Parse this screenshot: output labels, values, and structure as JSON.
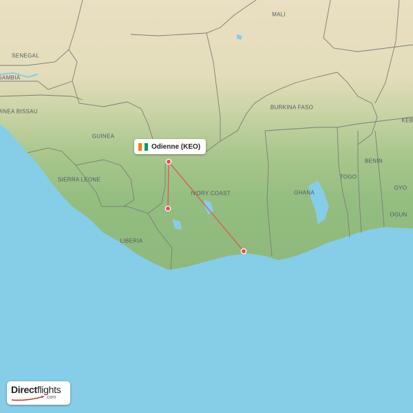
{
  "map": {
    "country_labels": [
      {
        "key": "mali",
        "text": "MALI"
      },
      {
        "key": "senegal",
        "text": "SENEGAL"
      },
      {
        "key": "gambia",
        "text": "GAMBIA"
      },
      {
        "key": "guinea_bissau",
        "text": "GUINEA BISSAU"
      },
      {
        "key": "guinea",
        "text": "GUINEA"
      },
      {
        "key": "sierra_leone",
        "text": "SIERRA LEONE"
      },
      {
        "key": "liberia",
        "text": "LIBERIA"
      },
      {
        "key": "ivory_coast",
        "text": "IVORY COAST"
      },
      {
        "key": "burkina_faso",
        "text": "BURKINA FASO"
      },
      {
        "key": "ghana",
        "text": "GHANA"
      },
      {
        "key": "togo",
        "text": "TOGO"
      },
      {
        "key": "benin",
        "text": "BENIN"
      },
      {
        "key": "oyo",
        "text": "OYO"
      },
      {
        "key": "ogun",
        "text": "OGUN"
      },
      {
        "key": "keb",
        "text": "KEB"
      }
    ],
    "origin": {
      "label": "Odienne (KEO)",
      "flag_colors": [
        "#F77F00",
        "#FFFFFF",
        "#009E60"
      ]
    },
    "route_color": "#e0504e",
    "sea_color": "#86cde8"
  },
  "brand": {
    "name_bold": "Direct",
    "name_regular": "flights",
    "domain": ".com"
  }
}
